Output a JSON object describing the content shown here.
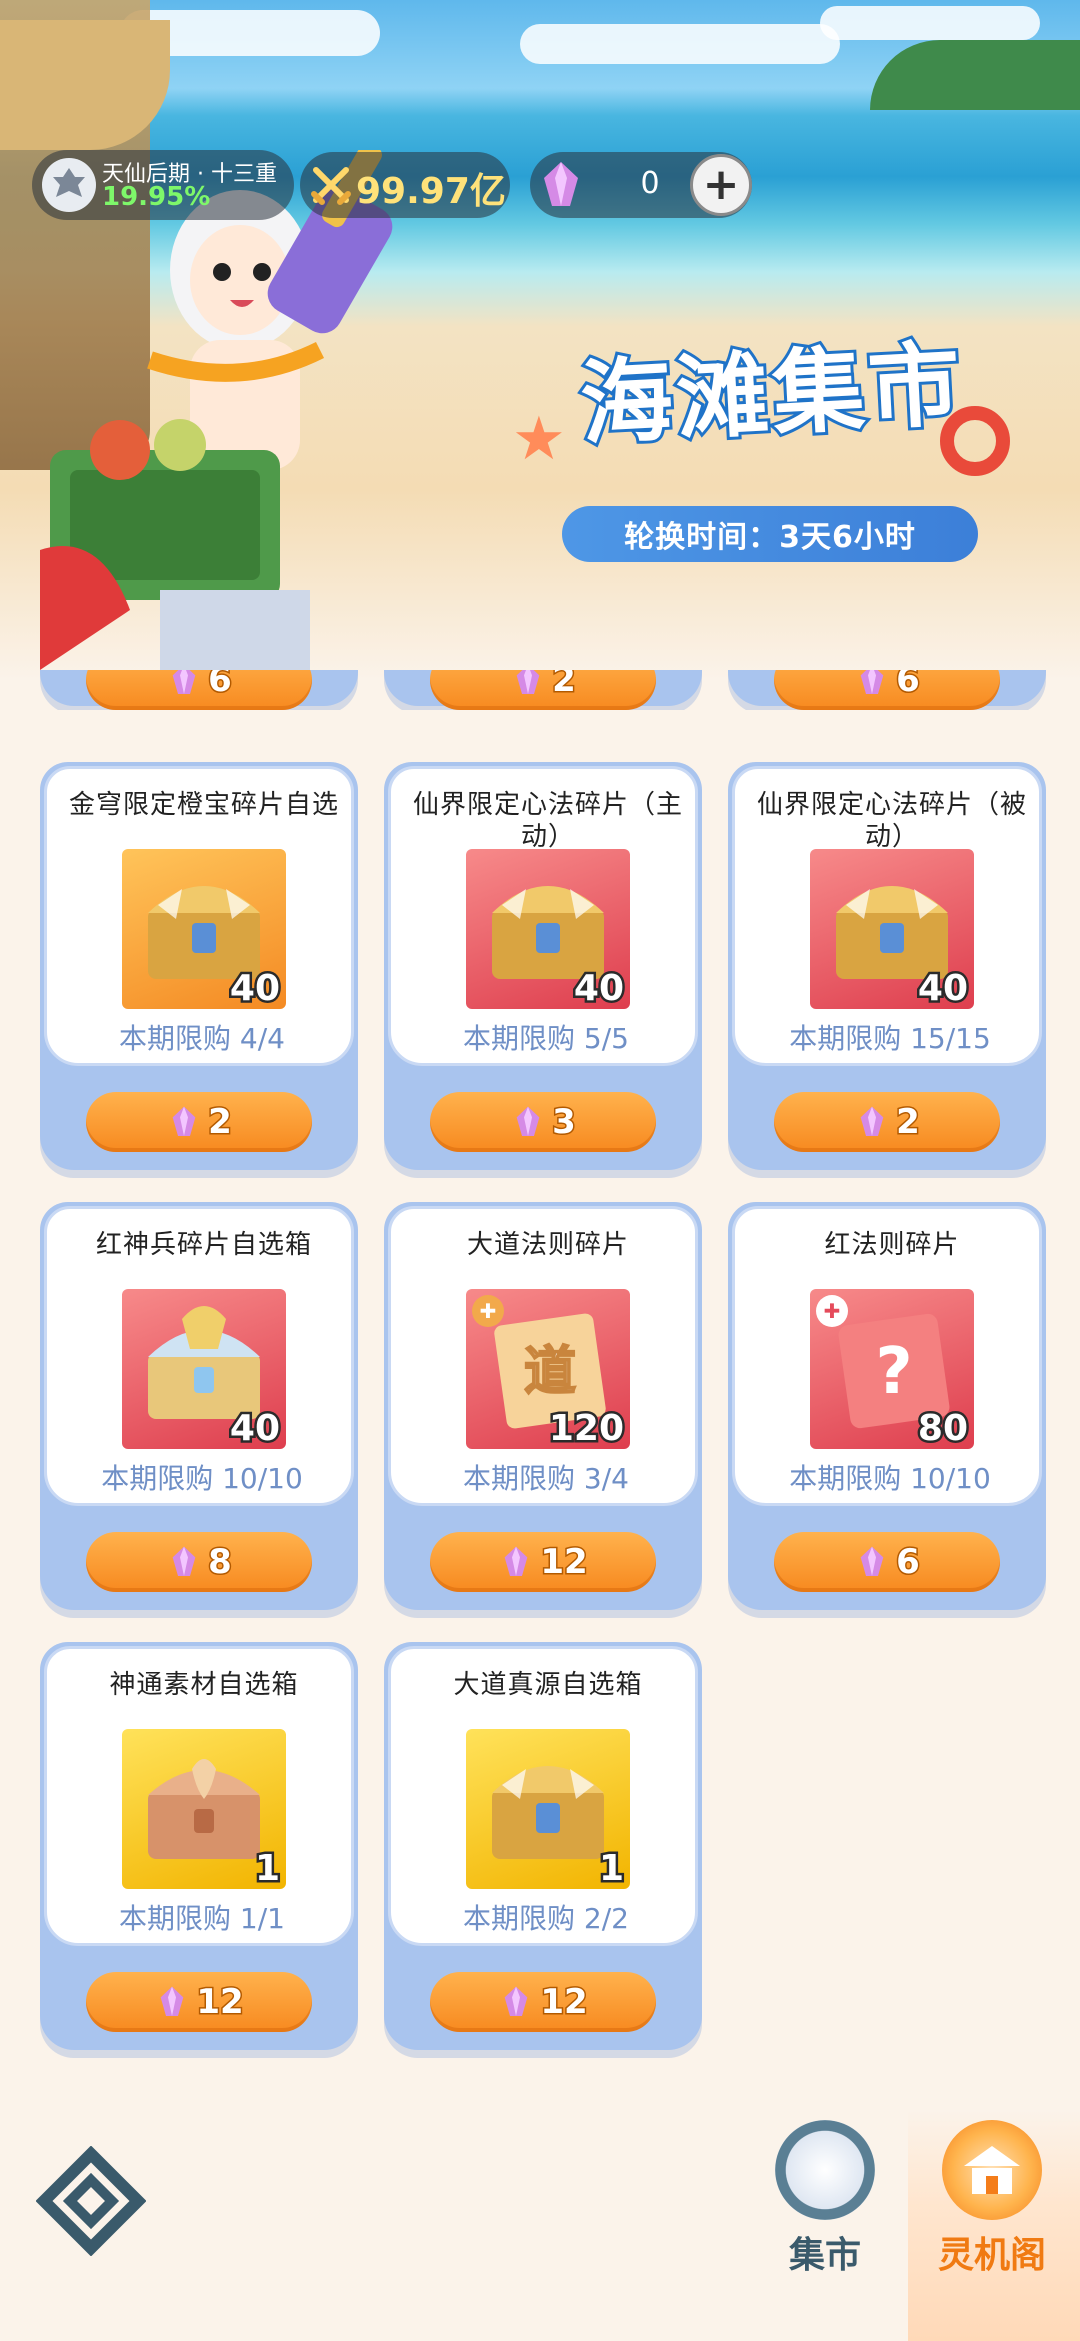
{
  "header": {
    "realm_name": "天仙后期 · 十三重",
    "realm_percent": "19.95%",
    "power_value": "99.97亿",
    "gem_count": "0",
    "add_label": "+",
    "event_title": "海滩集市",
    "rotation_timer": "轮换时间：3天6小时"
  },
  "partial_row": [
    {
      "price": "6"
    },
    {
      "price": "2"
    },
    {
      "price": "6"
    }
  ],
  "items": [
    {
      "name": "金穹限定橙宝碎片自选",
      "qty": "40",
      "limit": "本期限购 4/4",
      "price": "2",
      "bg": "orange",
      "icon": "golden-chest-icon"
    },
    {
      "name": "仙界限定心法碎片（主动）",
      "qty": "40",
      "limit": "本期限购 5/5",
      "price": "3",
      "bg": "red",
      "icon": "golden-chest-icon"
    },
    {
      "name": "仙界限定心法碎片（被动）",
      "qty": "40",
      "limit": "本期限购 15/15",
      "price": "2",
      "bg": "red",
      "icon": "golden-chest-icon"
    },
    {
      "name": "红神兵碎片自选箱",
      "qty": "40",
      "limit": "本期限购 10/10",
      "price": "8",
      "bg": "red",
      "icon": "dragon-chest-icon"
    },
    {
      "name": "大道法则碎片",
      "qty": "120",
      "limit": "本期限购 3/4",
      "price": "12",
      "bg": "red",
      "icon": "dao-shard-icon"
    },
    {
      "name": "红法则碎片",
      "qty": "80",
      "limit": "本期限购 10/10",
      "price": "6",
      "bg": "red",
      "icon": "mystery-shard-icon"
    },
    {
      "name": "神通素材自选箱",
      "qty": "1",
      "limit": "本期限购 1/1",
      "price": "12",
      "bg": "yellow",
      "icon": "phoenix-chest-icon"
    },
    {
      "name": "大道真源自选箱",
      "qty": "1",
      "limit": "本期限购 2/2",
      "price": "12",
      "bg": "yellow",
      "icon": "golden-chest-icon"
    }
  ],
  "nav": {
    "market_label": "集市",
    "lingji_label": "灵机阁"
  },
  "colors": {
    "accent_orange": "#f7891f",
    "card_blue": "#a9c4ee",
    "limit_text": "#6f8fc6",
    "title_blue": "#1f73c8"
  }
}
